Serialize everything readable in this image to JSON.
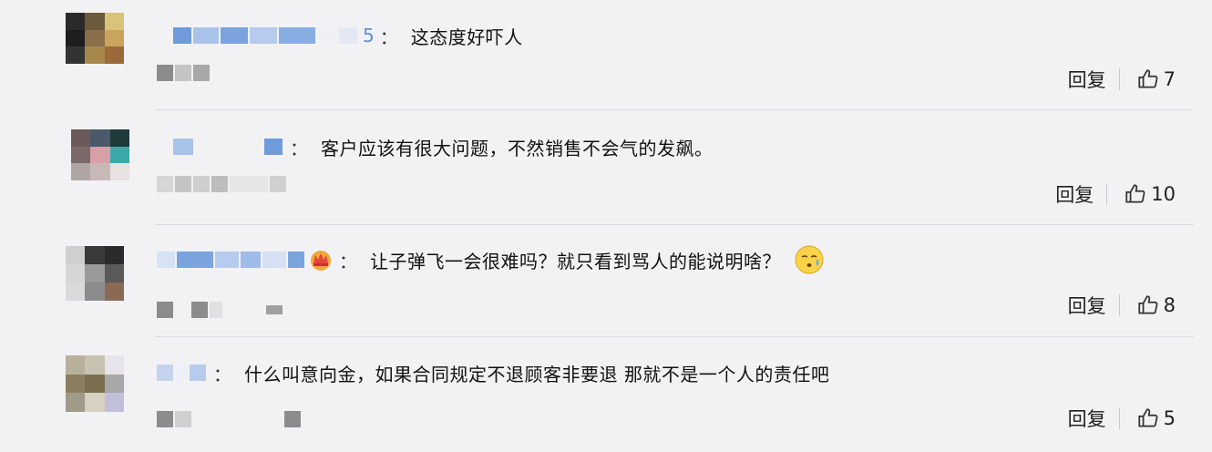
{
  "comments": [
    {
      "username_visible_suffix": "5",
      "colon": "：",
      "text": "这态度好吓人",
      "reply_label": "回复",
      "likes": "7",
      "like_icon": "thumbs-up-icon"
    },
    {
      "colon": "：",
      "text": "客户应该有很大问题，不然销售不会气的发飙。",
      "reply_label": "回复",
      "likes": "10",
      "like_icon": "thumbs-up-icon"
    },
    {
      "colon": "：",
      "text": "让子弹飞一会很难吗？就只看到骂人的能说明啥？",
      "badge_icon": "crown-badge-icon",
      "emoji_icon": "sweat-face-emoji-icon",
      "reply_label": "回复",
      "likes": "8",
      "like_icon": "thumbs-up-icon"
    },
    {
      "colon": "：",
      "text": "什么叫意向金，如果合同规定不退顾客非要退 那就不是一个人的责任吧",
      "reply_label": "回复",
      "likes": "5",
      "like_icon": "thumbs-up-icon"
    }
  ],
  "colors": {
    "background": "#f2f2f5",
    "blurred_username": "#7aa3de",
    "blurred_meta": "#8c8c8c",
    "divider": "#dcdce0"
  }
}
